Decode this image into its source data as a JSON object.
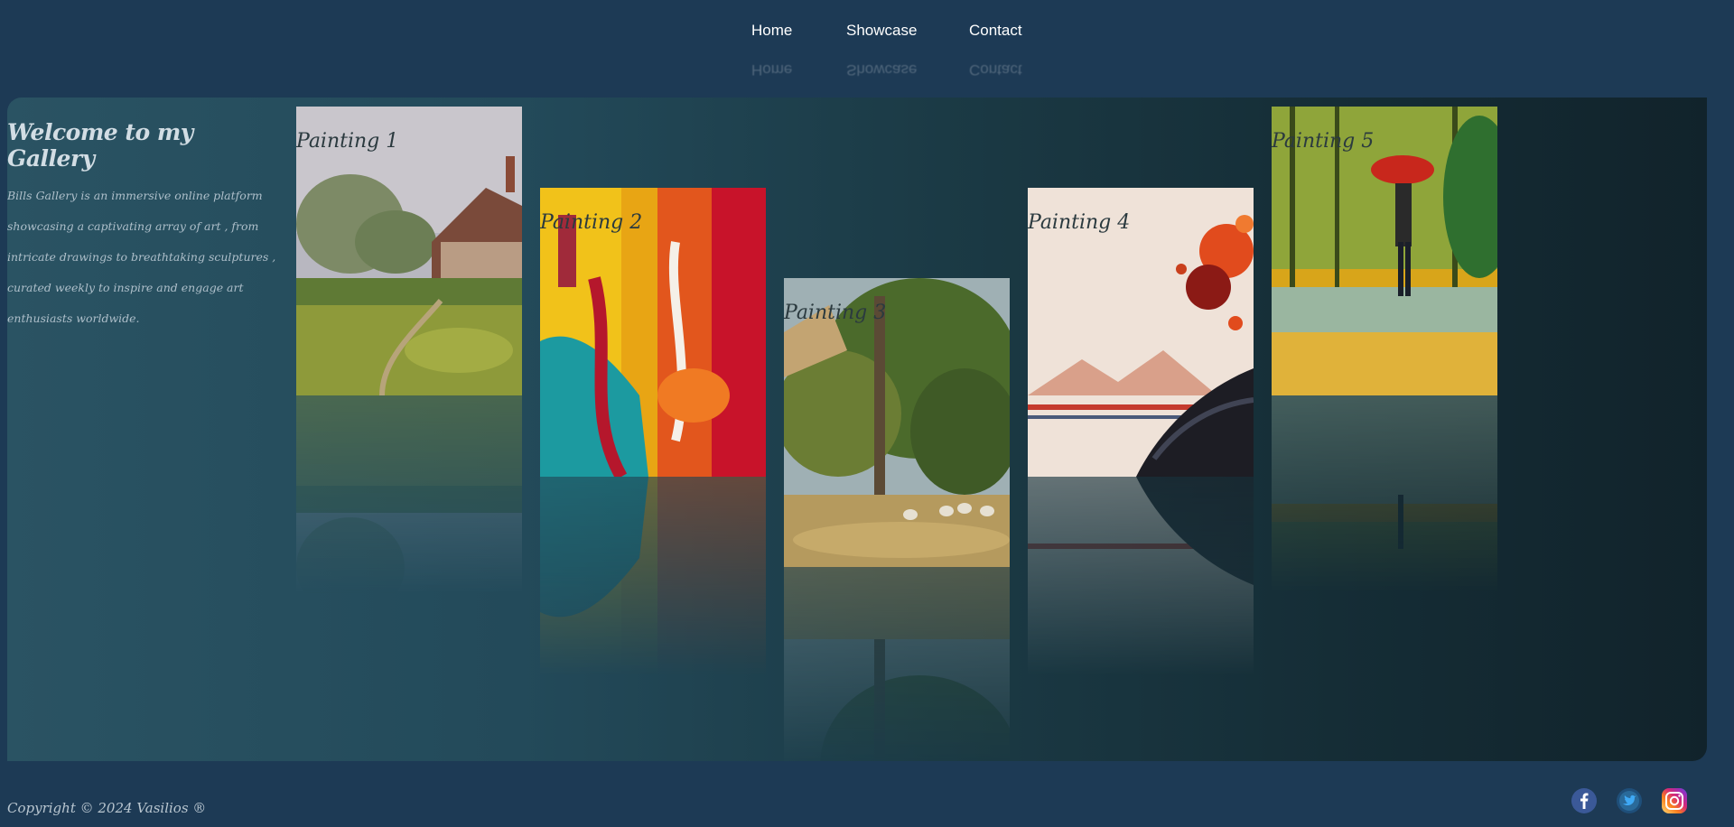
{
  "nav": {
    "items": [
      {
        "label": "Home"
      },
      {
        "label": "Showcase"
      },
      {
        "label": "Contact"
      }
    ]
  },
  "intro": {
    "title": "Welcome to my Gallery",
    "text": "Bills Gallery is an immersive online platform showcasing a captivating array of art , from intricate drawings to breathtaking sculptures , curated weekly to inspire and engage art enthusiasts worldwide."
  },
  "paintings": [
    {
      "label": "Painting 1",
      "subject": "cottage-landscape"
    },
    {
      "label": "Painting 2",
      "subject": "abstract-colors"
    },
    {
      "label": "Painting 3",
      "subject": "forest-sheep"
    },
    {
      "label": "Painting 4",
      "subject": "ink-splash"
    },
    {
      "label": "Painting 5",
      "subject": "rainy-walk"
    }
  ],
  "footer": {
    "copyright": "Copyright © 2024 Vasilios ®",
    "social": [
      {
        "icon": "facebook-icon",
        "color": "#3b5998"
      },
      {
        "icon": "twitter-icon",
        "color": "#1da1f2"
      },
      {
        "icon": "instagram-icon",
        "color": "#d62976"
      }
    ]
  },
  "colors": {
    "background": "#1d3a55",
    "panel_start": "#2a5363",
    "panel_end": "#11232b"
  }
}
